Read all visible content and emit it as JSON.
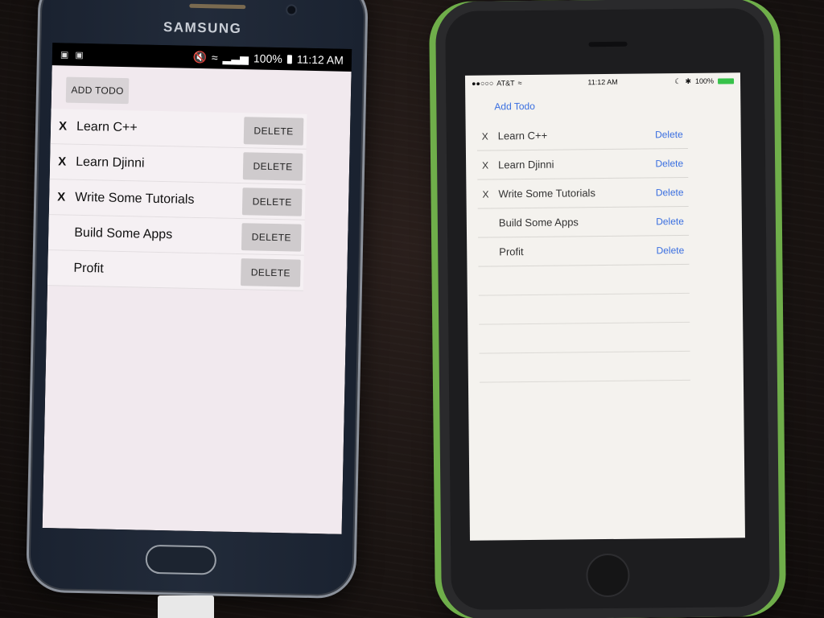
{
  "android": {
    "brand": "SAMSUNG",
    "status": {
      "time": "11:12 AM",
      "battery": "100%"
    },
    "add_button": "ADD TODO",
    "items": [
      {
        "mark": "X",
        "title": "Learn C++",
        "delete": "DELETE"
      },
      {
        "mark": "X",
        "title": "Learn Djinni",
        "delete": "DELETE"
      },
      {
        "mark": "X",
        "title": "Write Some Tutorials",
        "delete": "DELETE"
      },
      {
        "mark": "",
        "title": "Build Some Apps",
        "delete": "DELETE"
      },
      {
        "mark": "",
        "title": "Profit",
        "delete": "DELETE"
      }
    ]
  },
  "ios": {
    "status": {
      "carrier": "AT&T",
      "time": "11:12 AM",
      "battery": "100%"
    },
    "add_button": "Add Todo",
    "items": [
      {
        "mark": "X",
        "title": "Learn C++",
        "delete": "Delete"
      },
      {
        "mark": "X",
        "title": "Learn Djinni",
        "delete": "Delete"
      },
      {
        "mark": "X",
        "title": "Write Some Tutorials",
        "delete": "Delete"
      },
      {
        "mark": "",
        "title": "Build Some Apps",
        "delete": "Delete"
      },
      {
        "mark": "",
        "title": "Profit",
        "delete": "Delete"
      }
    ],
    "empty_rows": 4
  },
  "colors": {
    "ios_accent": "#3a6fe0",
    "android_button": "#cfcbcd",
    "case_green": "#6fae4a"
  }
}
